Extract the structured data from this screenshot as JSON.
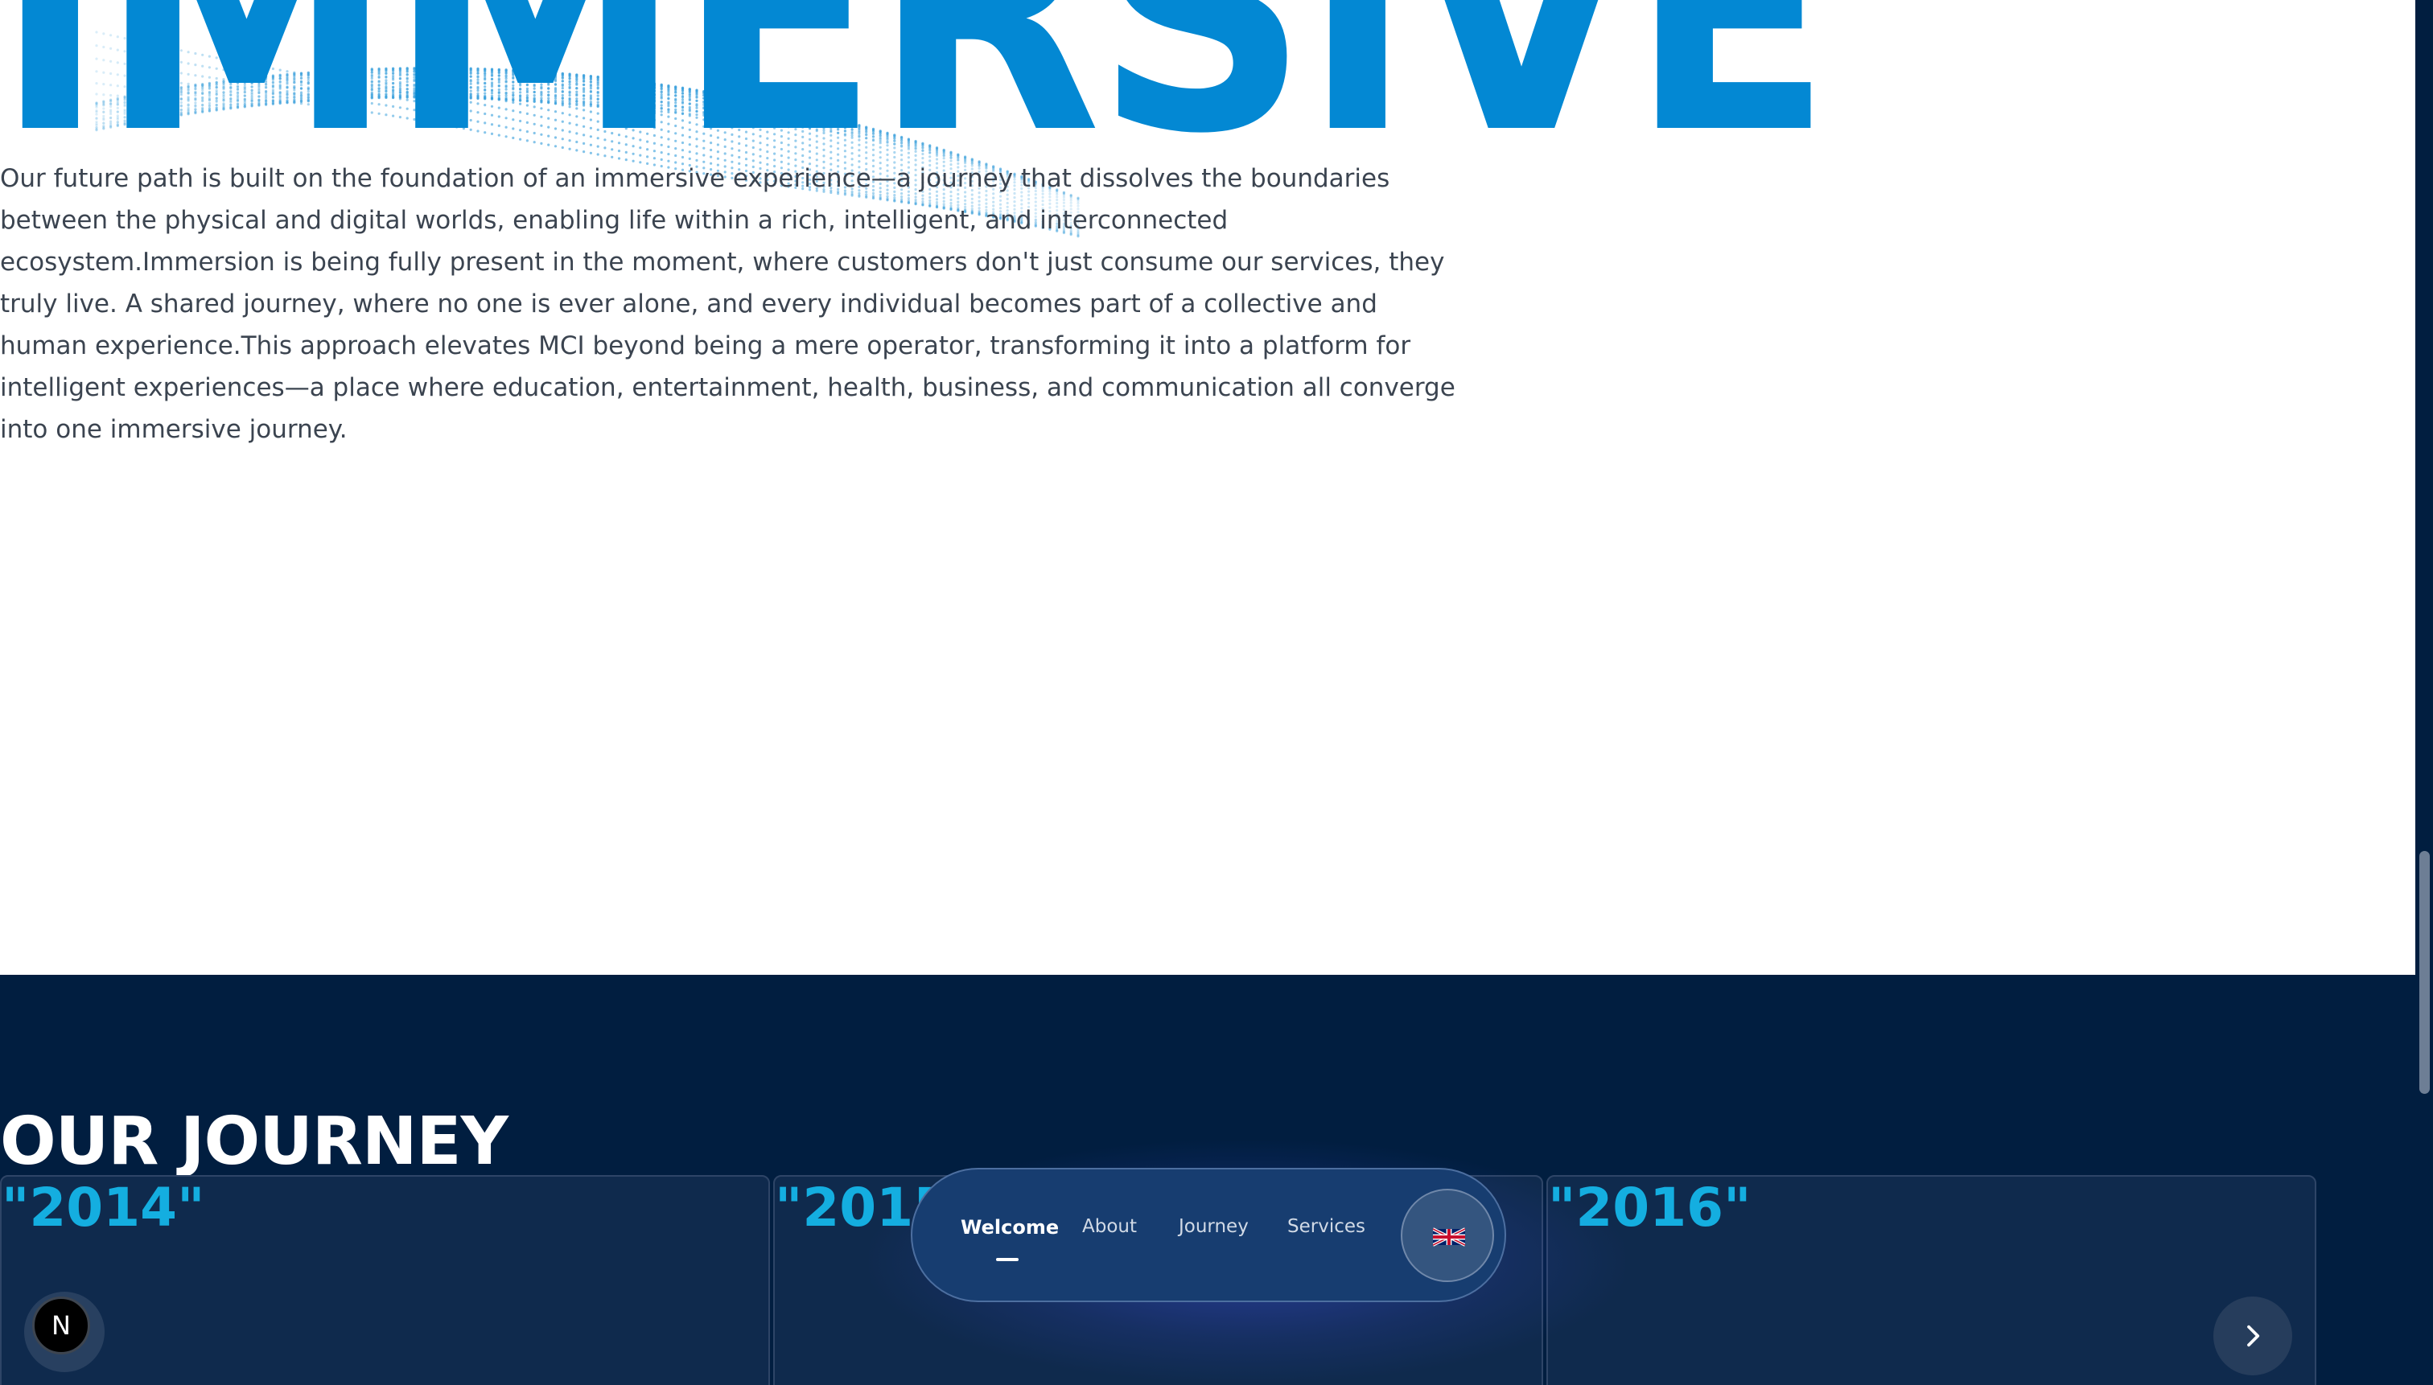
{
  "hero": {
    "word": "IMMERSIVE",
    "paragraph": "Our future path is built on the foundation of an immersive experience—a journey that dissolves the boundaries between the physical and digital worlds, enabling life within a rich, intelligent, and interconnected ecosystem.Immersion is being fully present in the moment, where customers don't just consume our services, they truly live. A shared journey, where no one is ever alone, and every individual becomes part of a collective and human experience.This approach elevates MCI beyond being a mere operator, transforming it into a platform for intelligent experiences—a place where education, entertainment, health, business, and communication all converge into one immersive journey."
  },
  "journey": {
    "title": "OUR JOURNEY",
    "cards": [
      {
        "year": "\"2014\""
      },
      {
        "year": "\"2015\""
      },
      {
        "year": "\"2016\""
      }
    ]
  },
  "nav": {
    "items": [
      {
        "label": "Welcome",
        "active": true
      },
      {
        "label": "About",
        "active": false
      },
      {
        "label": "Journey",
        "active": false
      },
      {
        "label": "Services",
        "active": false
      }
    ],
    "language_icon": "uk-flag-icon"
  },
  "floating": {
    "n_button_label": "N",
    "next_icon": "chevron-right-icon"
  },
  "colors": {
    "accent_blue": "#0388d3",
    "journey_bg": "#011e40",
    "year_color": "#14aee0",
    "nav_bg": "#173d70"
  }
}
